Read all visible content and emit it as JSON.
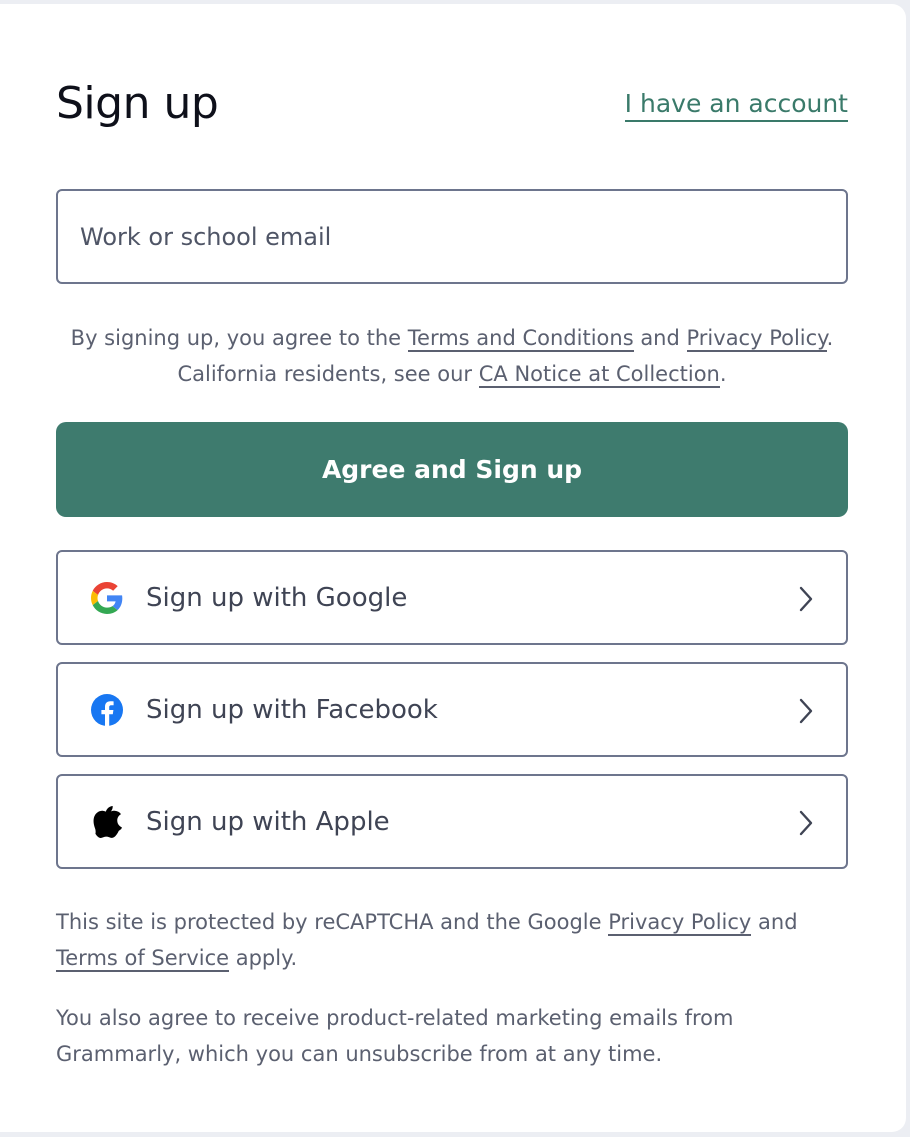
{
  "header": {
    "title": "Sign up",
    "account_link": "I have an account"
  },
  "email": {
    "placeholder": "Work or school email",
    "value": ""
  },
  "legal": {
    "prefix": "By signing up, you agree to the ",
    "terms_link": "Terms and Conditions",
    "and": " and ",
    "privacy_link": "Privacy Policy",
    "period1": ".",
    "ca_prefix": "California residents, see our ",
    "ca_link": "CA Notice at Collection",
    "period2": "."
  },
  "primary_button": "Agree and Sign up",
  "social": [
    {
      "label": "Sign up with Google",
      "icon": "google-icon"
    },
    {
      "label": "Sign up with Facebook",
      "icon": "facebook-icon"
    },
    {
      "label": "Sign up with Apple",
      "icon": "apple-icon"
    }
  ],
  "recaptcha": {
    "prefix": "This site is protected by reCAPTCHA and the Google ",
    "privacy_link": "Privacy Policy",
    "and": " and ",
    "tos_link": "Terms of Service",
    "suffix": " apply."
  },
  "marketing": "You also agree to receive product-related marketing emails from Grammarly, which you can unsubscribe from at any time.",
  "colors": {
    "brand_green": "#3e7b6e",
    "link_green": "#3a7a6a",
    "border": "#6d758d",
    "text_muted": "#5b6070"
  }
}
